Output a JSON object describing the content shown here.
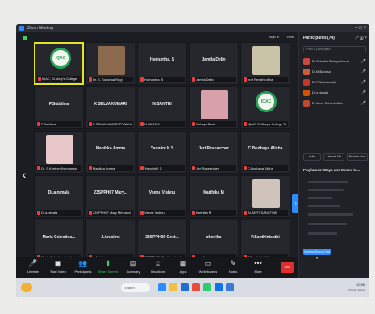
{
  "window": {
    "title": "Zoom Meeting",
    "controls": "– □ ×"
  },
  "topbar": {
    "signin": "Sign in",
    "view": "View"
  },
  "tiles": [
    {
      "display": "",
      "label": "IQAC, St.Mary's College",
      "type": "logo",
      "logo_text": "IQAC",
      "active": true
    },
    {
      "display": "",
      "label": "Dr. S. Sobiaraa Regi",
      "type": "photo",
      "photo_color": "#8c6a4f"
    },
    {
      "display": "Hemantha. S",
      "label": "Hamantha. S"
    },
    {
      "display": "Jamila Delin",
      "label": "Jamila Delin"
    },
    {
      "display": "",
      "label": "prof Revathi ditha",
      "type": "photo",
      "photo_color": "#c9c4a8"
    },
    {
      "display": "P.Subithra",
      "label": "P.Subithra"
    },
    {
      "display": "K SELVAKUMARI",
      "label": "K SELVAKUMARI PRABHA"
    },
    {
      "display": "N SANTHI",
      "label": "N SANTHI"
    },
    {
      "display": "",
      "label": "Sahaya Dani",
      "type": "photo",
      "photo_color": "#d8a0a8"
    },
    {
      "display": "",
      "label": "IQAC, St.Mary's College Tt",
      "type": "logo",
      "logo_text": "IQAC"
    },
    {
      "display": "",
      "label": "Dr. S.Keethe Vishnumaal",
      "type": "photo",
      "photo_color": "#e8c7c8"
    },
    {
      "display": "Manikka Amma",
      "label": "Manikka Amma"
    },
    {
      "display": "Yasmini K S",
      "label": "Yasmini K S"
    },
    {
      "display": "Jeri Researcher",
      "label": "Jeri Researcher"
    },
    {
      "display": "C.Bruthaya Alisha",
      "label": "C.Bruthaya Alisha"
    },
    {
      "display": "Dr.a.nimala",
      "label": "Dr.a.nimala"
    },
    {
      "display": "23SPPH07 Mary...",
      "label": "23SPPH07 Mary Mirinalini"
    },
    {
      "display": "Veena Vishnu",
      "label": "Veena Vishnu"
    },
    {
      "display": "Karthika M",
      "label": "Karthika M"
    },
    {
      "display": "",
      "label": "ALBERT SANCTINE",
      "type": "photo",
      "photo_color": "#cfc3bb"
    },
    {
      "display": "Maria Celestina...",
      "label": "Maria Celestina Anisha"
    },
    {
      "display": "J.Anjaline",
      "label": "J.Anjaline"
    },
    {
      "display": "23SPPH06 Geet...",
      "label": "23SPPH06 Geethapriyadi"
    },
    {
      "display": "chenika",
      "label": "chenika"
    },
    {
      "display": "P.Santhinisathi",
      "label": "P.Santhinisathi"
    }
  ],
  "toolbar": [
    {
      "icon": "🎤",
      "label": "Unmute",
      "name": "unmute"
    },
    {
      "icon": "▣",
      "label": "Start Video",
      "name": "start-video"
    },
    {
      "icon": "👥",
      "label": "Participants",
      "name": "participants"
    },
    {
      "icon": "⬆",
      "label": "Share Screen",
      "name": "share-screen"
    },
    {
      "icon": "▤",
      "label": "Summary",
      "name": "summary"
    },
    {
      "icon": "☺",
      "label": "Reactions",
      "name": "reactions"
    },
    {
      "icon": "▦",
      "label": "Apps",
      "name": "apps"
    },
    {
      "icon": "▭",
      "label": "Whiteboards",
      "name": "whiteboards"
    },
    {
      "icon": "✎",
      "label": "Notes",
      "name": "notes"
    },
    {
      "icon": "•••",
      "label": "More",
      "name": "more"
    }
  ],
  "end_button": "End",
  "panel": {
    "title": "Participants (74)",
    "header_icons": "⤢ ⓧ ×",
    "search_placeholder": "Find a participant",
    "participants": [
      {
        "name": "Dr.Celestia Sahaya Jeena",
        "avatar_color": "#c94a3a"
      },
      {
        "name": "Dr.M.Banusu",
        "avatar_color": "#d05a3c"
      },
      {
        "name": "Dr.P.Subbaraddy",
        "avatar_color": "#c0392b"
      },
      {
        "name": "Dr.s.nimala",
        "avatar_color": "#d35400"
      },
      {
        "name": "E. Jenci Selva Anitha",
        "avatar_color": "#c2492f"
      }
    ],
    "buttons": {
      "invite": "Invite",
      "mute_all": "Unmute Me",
      "reclaim": "Reclaim Host"
    },
    "poll_title": "Playlumes: Ways and Means to...",
    "group_label": "Meeting Group Chat ▾"
  },
  "taskbar": {
    "search": "Search",
    "time": "10:56",
    "date": "27-09-2024",
    "apps": [
      "#2d8cff",
      "#f0c040",
      "#1f6fd1",
      "#e74c3c",
      "#2ecc71",
      "#0e72ed",
      "#3a7bd5"
    ]
  }
}
